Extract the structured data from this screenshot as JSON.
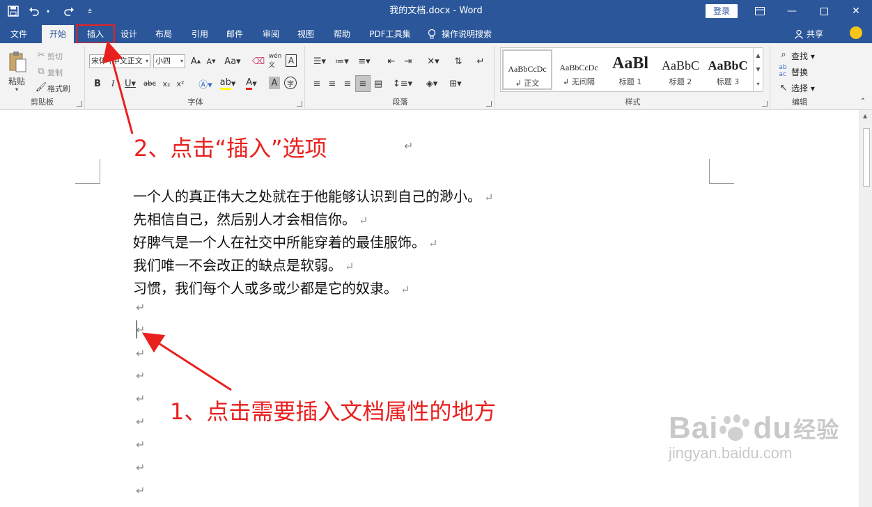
{
  "titlebar": {
    "doc_title": "我的文档.docx  -  Word",
    "login_label": "登录",
    "icons": [
      "save-icon",
      "undo-icon",
      "redo-icon",
      "customize-qat-icon"
    ]
  },
  "tabs": [
    {
      "label": "文件"
    },
    {
      "label": "开始"
    },
    {
      "label": "插入"
    },
    {
      "label": "设计"
    },
    {
      "label": "布局"
    },
    {
      "label": "引用"
    },
    {
      "label": "邮件"
    },
    {
      "label": "审阅"
    },
    {
      "label": "视图"
    },
    {
      "label": "帮助"
    },
    {
      "label": "PDF工具集"
    }
  ],
  "tell_me": "操作说明搜索",
  "share": "共享",
  "clipboard": {
    "paste": "粘贴",
    "cut": "剪切",
    "copy": "复制",
    "format_painter": "格式刷",
    "label": "剪贴板"
  },
  "font": {
    "font_name": "宋体 (中文正文",
    "font_size": "小四",
    "label": "字体"
  },
  "paragraph": {
    "label": "段落"
  },
  "styles": {
    "label": "样式",
    "items": [
      {
        "preview": "AaBbCcDc",
        "name": "正文"
      },
      {
        "preview": "AaBbCcDc",
        "name": "无间隔"
      },
      {
        "preview": "AaBl",
        "name": "标题 1"
      },
      {
        "preview": "AaBbC",
        "name": "标题 2"
      },
      {
        "preview": "AaBbC",
        "name": "标题 3"
      }
    ]
  },
  "editing": {
    "find": "查找",
    "replace": "替换",
    "select": "选择",
    "label": "编辑"
  },
  "document": {
    "paragraphs": [
      "一个人的真正伟大之处就在于他能够认识到自己的渺小。",
      "先相信自己，然后别人才会相信你。",
      "好脾气是一个人在社交中所能穿着的最佳服饰。",
      "我们唯一不会改正的缺点是软弱。",
      "习惯，我们每个人或多或少都是它的奴隶。"
    ],
    "paragraph_mark": "↵"
  },
  "annotations": {
    "step2": "2、点击“插入”选项",
    "step1": "1、点击需要插入文档属性的地方"
  },
  "watermark": {
    "main": "Bai",
    "main2": "du",
    "cn": "经验",
    "sub": "jingyan.baidu.com"
  },
  "colors": {
    "ribbon_blue": "#2b579a",
    "annotation_red": "#e8201e"
  }
}
